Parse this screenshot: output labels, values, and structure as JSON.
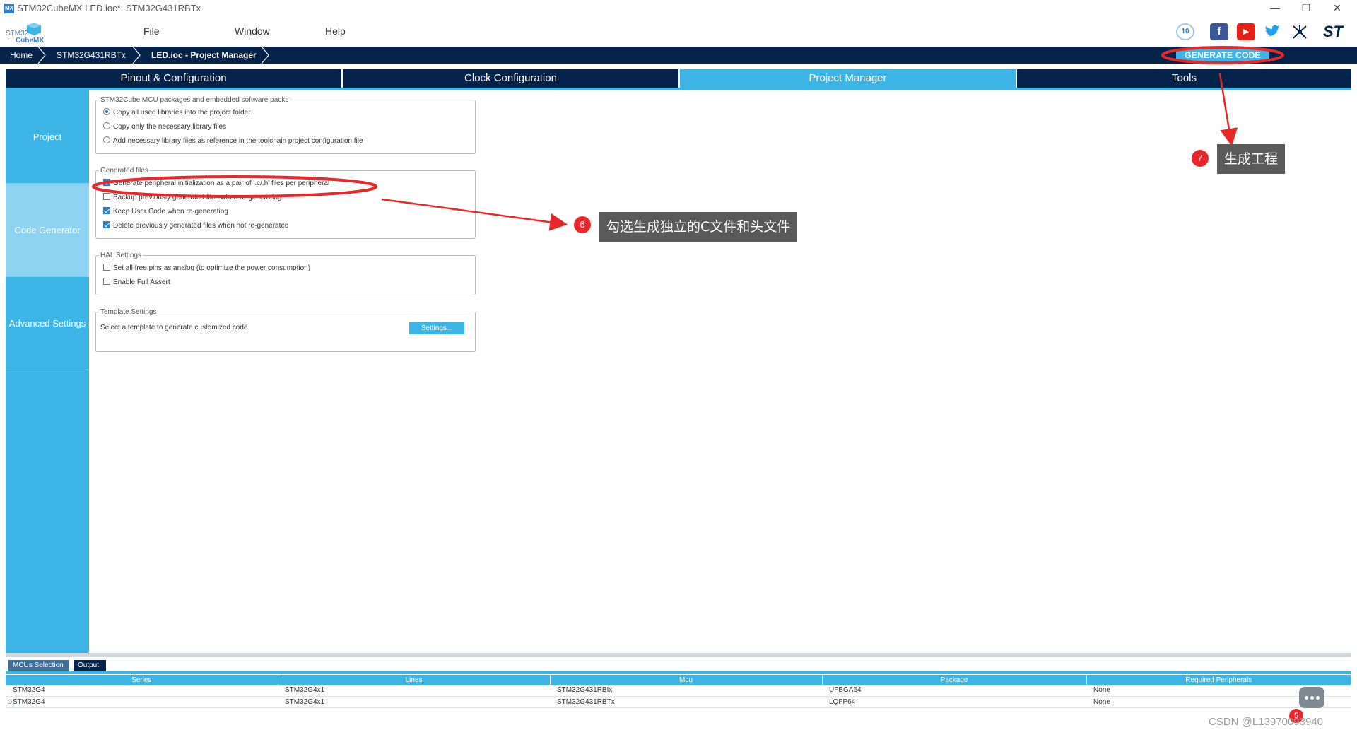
{
  "window": {
    "title": "STM32CubeMX LED.ioc*: STM32G431RBTx",
    "app_icon_text": "MX",
    "controls": [
      "—",
      "❐",
      "✕"
    ]
  },
  "logo": {
    "line1": "STM32",
    "line2": "CubeMX"
  },
  "menu": [
    "File",
    "Window",
    "Help"
  ],
  "toolbar_icons": {
    "anniversary": "10",
    "facebook": "f",
    "youtube": "▶",
    "twitter": "twitter-icon",
    "network": "network-icon",
    "st_logo": "ST"
  },
  "breadcrumb": [
    "Home",
    "STM32G431RBTx",
    "LED.ioc - Project Manager"
  ],
  "generate_button": "GENERATE CODE",
  "tabs": [
    {
      "label": "Pinout & Configuration",
      "active": false
    },
    {
      "label": "Clock Configuration",
      "active": false
    },
    {
      "label": "Project Manager",
      "active": true
    },
    {
      "label": "Tools",
      "active": false
    }
  ],
  "sidebar": [
    {
      "label": "Project",
      "active": false
    },
    {
      "label": "Code Generator",
      "active": true
    },
    {
      "label": "Advanced Settings",
      "active": false
    }
  ],
  "packs": {
    "legend": "STM32Cube MCU packages and embedded software packs",
    "options": [
      {
        "label": "Copy all used libraries into the project folder",
        "selected": true
      },
      {
        "label": "Copy only the necessary library files",
        "selected": false
      },
      {
        "label": "Add necessary library files as reference in the toolchain project configuration file",
        "selected": false
      }
    ]
  },
  "generated": {
    "legend": "Generated files",
    "options": [
      {
        "label": "Generate peripheral initialization as a pair of '.c/.h' files per peripheral",
        "checked": true
      },
      {
        "label": "Backup previously generated files when re-generating",
        "checked": false
      },
      {
        "label": "Keep User Code when re-generating",
        "checked": true
      },
      {
        "label": "Delete previously generated files when not re-generated",
        "checked": true
      }
    ]
  },
  "hal": {
    "legend": "HAL Settings",
    "options": [
      {
        "label": "Set all free pins as analog (to optimize the power consumption)",
        "checked": false
      },
      {
        "label": "Enable Full Assert",
        "checked": false
      }
    ]
  },
  "template": {
    "legend": "Template Settings",
    "text": "Select a template to generate customized code",
    "button": "Settings..."
  },
  "annotations": {
    "step6_number": "6",
    "step6_text": "勾选生成独立的C文件和头文件",
    "step7_number": "7",
    "step7_text": "生成工程",
    "step5_number": "5",
    "accent_red": "#e8272a"
  },
  "bottom_tabs": [
    {
      "label": "MCUs Selection",
      "active": false
    },
    {
      "label": "Output",
      "active": true
    }
  ],
  "table": {
    "headers": [
      "Series",
      "Lines",
      "Mcu",
      "Package",
      "Required Peripherals"
    ],
    "rows": [
      {
        "series": "STM32G4",
        "lines": "STM32G4x1",
        "mcu": "STM32G431RBIx",
        "package": "UFBGA64",
        "peripherals": "None",
        "selected": false
      },
      {
        "series": "STM32G4",
        "lines": "STM32G4x1",
        "mcu": "STM32G431RBTx",
        "package": "LQFP64",
        "peripherals": "None",
        "selected": true
      }
    ]
  },
  "watermark": "CSDN @L13970093940",
  "colors": {
    "navy": "#03234b",
    "accent": "#3cb4e6",
    "sidebar_active": "#8fd3f2"
  }
}
